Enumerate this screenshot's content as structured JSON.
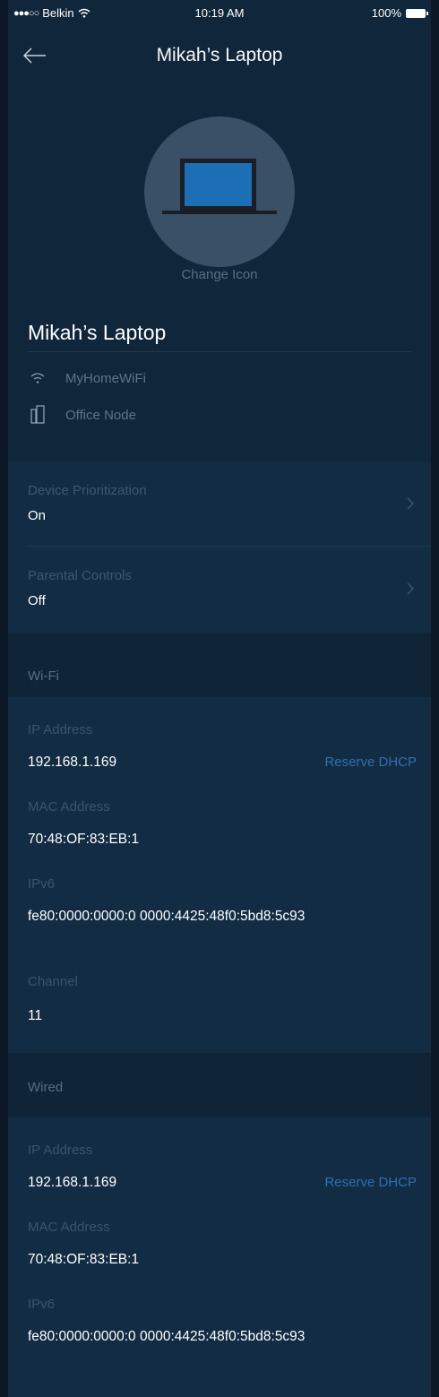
{
  "status_bar": {
    "carrier": "Belkin",
    "time": "10:19 AM",
    "battery": "100%"
  },
  "nav": {
    "title": "Mikah’s Laptop",
    "back_icon": "arrow-left-icon"
  },
  "avatar": {
    "icon": "laptop-icon",
    "change_label": "Change Icon"
  },
  "device": {
    "name": "Mikah’s Laptop",
    "network": "MyHomeWiFi",
    "node": "Office Node"
  },
  "settings": [
    {
      "label": "Device Prioritization",
      "value": "On"
    },
    {
      "label": "Parental Controls",
      "value": "Off"
    }
  ],
  "wifi": {
    "heading": "Wi-Fi",
    "ip_label": "IP Address",
    "ip_value": "192.168.1.169",
    "reserve_label": "Reserve DHCP",
    "mac_label": "MAC Address",
    "mac_value": "70:48:OF:83:EB:1",
    "ipv6_label": "IPv6",
    "ipv6_value": "fe80:0000:0000:0 0000:4425:48f0:5bd8:5c93",
    "channel_label": "Channel",
    "channel_value": "11"
  },
  "wired": {
    "heading": "Wired",
    "ip_label": "IP Address",
    "ip_value": "192.168.1.169",
    "reserve_label": "Reserve DHCP",
    "mac_label": "MAC Address",
    "mac_value": "70:48:OF:83:EB:1",
    "ipv6_label": "IPv6",
    "ipv6_value": "fe80:0000:0000:0 0000:4425:48f0:5bd8:5c93"
  },
  "colors": {
    "background": "#10263a",
    "accent_link": "#2f6fb3",
    "muted_text": "#3c536a"
  }
}
